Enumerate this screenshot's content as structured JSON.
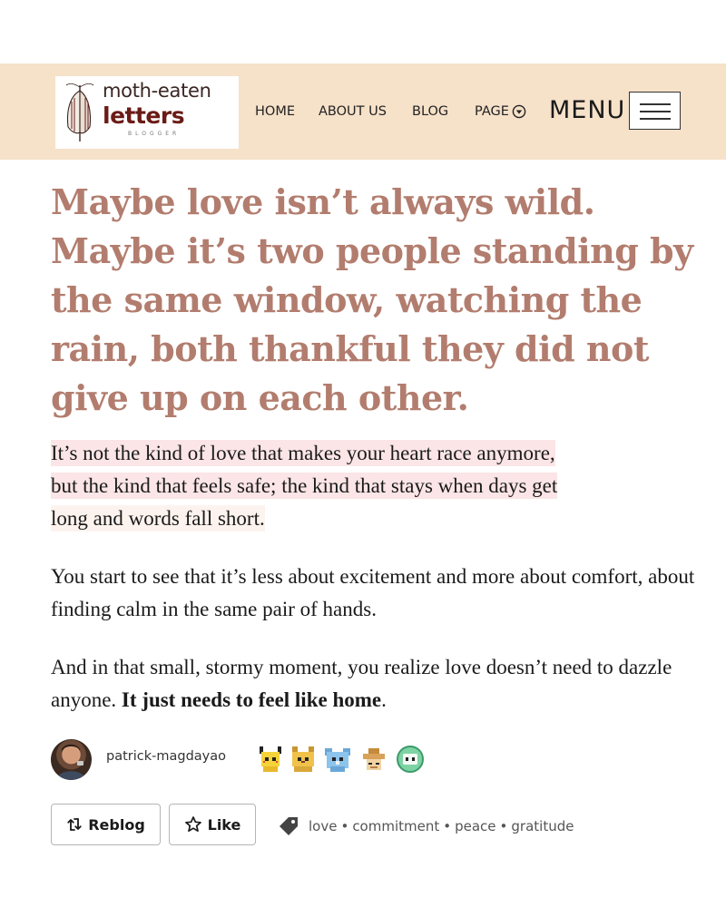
{
  "header": {
    "logo": {
      "line1": "moth-eaten",
      "line2": "letters",
      "line3": "BLOGGER"
    },
    "nav": [
      {
        "label": "HOME"
      },
      {
        "label": "ABOUT US"
      },
      {
        "label": "BLOG"
      },
      {
        "label": "PAGE"
      }
    ],
    "menu_label": "MENU",
    "background": "#f6e1c9"
  },
  "post": {
    "headline": "Maybe love isn’t always wild. Maybe it’s two people standing by the same window, watching the rain, both thankful they did not give up on each other.",
    "headline_color": "#b27d6e",
    "p1": {
      "line1": "It’s not the kind of love that makes your heart race anymore,",
      "line2": "but the kind that feels safe; the kind that stays when days get",
      "line3": "long and words fall short."
    },
    "p2": "You start to see that it’s less about excitement and more about comfort, about finding calm in the same pair of hands.",
    "p3_text": "And in that small, stormy moment, you realize love doesn’t need to dazzle anyone. ",
    "p3_bold": "It just needs to feel like home",
    "p3_end": "."
  },
  "author": {
    "name": "patrick-magdayao",
    "badges": [
      "pikachu-icon",
      "cat-icon",
      "bear-icon",
      "hat-icon",
      "robot-icon"
    ]
  },
  "actions": {
    "reblog_label": "Reblog",
    "like_label": "Like"
  },
  "tags": [
    "love",
    "commitment",
    "peace",
    "gratitude"
  ],
  "tag_separator": "•"
}
